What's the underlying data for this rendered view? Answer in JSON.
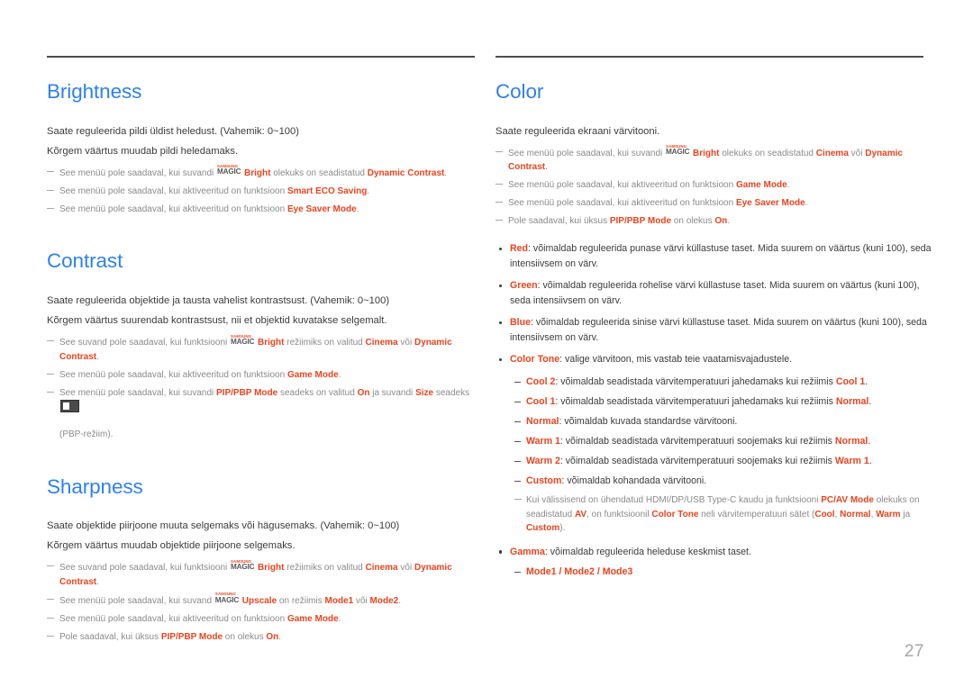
{
  "page": {
    "number": "27",
    "accent_heading_color": "#2f80ed",
    "highlight_color": "#e8441f",
    "body_color": "#3b3b3b",
    "note_color": "#8a8a8a"
  },
  "left_column": {
    "sections": [
      {
        "title": "Brightness",
        "body": [
          "Saate reguleerida pildi üldist heledust. (Vahemik: 0~100)",
          "Kõrgem väärtus muudab pildi heledamaks."
        ],
        "notes": {
          "n1_a": "See menüü pole saadaval, kui suvandi ",
          "n1_logo_top": "SAMSUNG",
          "n1_logo_bottom": "MAGIC",
          "n1_b": "Bright",
          "n1_c": " olekuks on seadistatud ",
          "n1_d": "Dynamic Contrast",
          "n1_e": ".",
          "n2_a": "See menüü pole saadaval, kui aktiveeritud on funktsioon ",
          "n2_b": "Smart ECO Saving",
          "n2_c": ".",
          "n3_a": "See menüü pole saadaval, kui aktiveeritud on funktsioon ",
          "n3_b": "Eye Saver Mode",
          "n3_c": "."
        }
      },
      {
        "title": "Contrast",
        "body": [
          "Saate reguleerida objektide ja tausta vahelist kontrastsust. (Vahemik: 0~100)",
          "Kõrgem väärtus suurendab kontrastsust, nii et objektid kuvatakse selgemalt."
        ],
        "notes": {
          "n1_a": "See suvand pole saadaval, kui funktsiooni ",
          "n1_logo_top": "SAMSUNG",
          "n1_logo_bottom": "MAGIC",
          "n1_b": "Bright",
          "n1_c": " režiimiks on valitud ",
          "n1_d": "Cinema",
          "n1_e": " või ",
          "n1_f": "Dynamic Contrast",
          "n1_g": ".",
          "n2_a": "See menüü pole saadaval, kui aktiveeritud on funktsioon ",
          "n2_b": "Game Mode",
          "n2_c": ".",
          "n3_a": "See menüü pole saadaval, kui suvandi ",
          "n3_b": "PIP/PBP Mode",
          "n3_c": " seadeks on valitud ",
          "n3_d": "On",
          "n3_e": " ja suvandi ",
          "n3_f": "Size",
          "n3_g": " seadeks ",
          "n3_h": "(PBP-režiim)."
        }
      },
      {
        "title": "Sharpness",
        "body": [
          "Saate objektide piirjoone muuta selgemaks või hägusemaks. (Vahemik: 0~100)",
          "Kõrgem väärtus muudab objektide piirjoone selgemaks."
        ],
        "notes": {
          "n1_a": "See suvand pole saadaval, kui funktsiooni ",
          "n1_logo_top": "SAMSUNG",
          "n1_logo_bottom": "MAGIC",
          "n1_b": "Bright",
          "n1_c": " režiimiks on valitud ",
          "n1_d": "Cinema",
          "n1_e": " või ",
          "n1_f": "Dynamic Contrast",
          "n1_g": ".",
          "n2_a": "See menüü pole saadaval, kui suvand ",
          "n2_logo_top": "SAMSUNG",
          "n2_logo_bottom": "MAGIC",
          "n2_b": "Upscale",
          "n2_c": " on režiimis ",
          "n2_d": "Mode1",
          "n2_e": " või ",
          "n2_f": "Mode2",
          "n2_g": ".",
          "n3_a": "See menüü pole saadaval, kui aktiveeritud on funktsioon ",
          "n3_b": "Game Mode",
          "n3_c": ".",
          "n4_a": "Pole saadaval, kui üksus ",
          "n4_b": "PIP/PBP Mode",
          "n4_c": " on olekus ",
          "n4_d": "On",
          "n4_e": "."
        }
      }
    ]
  },
  "right_column": {
    "section": {
      "title": "Color",
      "body": [
        "Saate reguleerida ekraani värvitooni."
      ],
      "notes": {
        "n1_a": "See menüü pole saadaval, kui suvandi ",
        "n1_logo_top": "SAMSUNG",
        "n1_logo_bottom": "MAGIC",
        "n1_b": "Bright",
        "n1_c": " olekuks on seadistatud ",
        "n1_d": "Cinema",
        "n1_e": " või ",
        "n1_f": "Dynamic Contrast",
        "n1_g": ".",
        "n2_a": "See menüü pole saadaval, kui aktiveeritud on funktsioon ",
        "n2_b": "Game Mode",
        "n2_c": ".",
        "n3_a": "See menüü pole saadaval, kui aktiveeritud on funktsioon ",
        "n3_b": "Eye Saver Mode",
        "n3_c": ".",
        "n4_a": "Pole saadaval, kui üksus ",
        "n4_b": "PIP/PBP Mode",
        "n4_c": " on olekus ",
        "n4_d": "On",
        "n4_e": "."
      },
      "bullets": {
        "b1_label": "Red",
        "b1_text": ": võimaldab reguleerida punase värvi küllastuse taset. Mida suurem on väärtus (kuni 100), seda intensiivsem on värv.",
        "b2_label": "Green",
        "b2_text": ": võimaldab reguleerida rohelise värvi küllastuse taset. Mida suurem on väärtus (kuni 100), seda intensiivsem on värv.",
        "b3_label": "Blue",
        "b3_text": ": võimaldab reguleerida sinise värvi küllastuse taset. Mida suurem on väärtus (kuni 100), seda intensiivsem on värv.",
        "b4_label": "Color Tone",
        "b4_text": ": valige värvitoon, mis vastab teie vaatamisvajadustele.",
        "b5_label": "Gamma",
        "b5_text": ": võimaldab reguleerida heleduse keskmist taset."
      },
      "color_tone_items": {
        "i1_label": "Cool 2",
        "i1_a": ": võimaldab seadistada värvitemperatuuri jahedamaks kui režiimis ",
        "i1_ref": "Cool 1",
        "i1_b": ".",
        "i2_label": "Cool 1",
        "i2_a": ": võimaldab seadistada värvitemperatuuri jahedamaks kui režiimis ",
        "i2_ref": "Normal",
        "i2_b": ".",
        "i3_label": "Normal",
        "i3_a": ": võimaldab kuvada standardse värvitooni.",
        "i4_label": "Warm 1",
        "i4_a": ": võimaldab seadistada värvitemperatuuri soojemaks kui režiimis ",
        "i4_ref": "Normal",
        "i4_b": ".",
        "i5_label": "Warm 2",
        "i5_a": ": võimaldab seadistada värvitemperatuuri soojemaks kui režiimis ",
        "i5_ref": "Warm 1",
        "i5_b": ".",
        "i6_label": "Custom",
        "i6_a": ": võimaldab kohandada värvitooni."
      },
      "color_tone_note": {
        "a": "Kui välissisend on ühendatud HDMI/DP/USB Type-C kaudu ja funktsiooni ",
        "b": "PC/AV Mode",
        "c": " olekuks on seadistatud ",
        "d": "AV",
        "e": ", on funktsioonil ",
        "f": "Color Tone",
        "g": " neli värvitemperatuuri sätet (",
        "h": "Cool",
        "i": ", ",
        "j": "Normal",
        "k": ", ",
        "l": "Warm",
        "m": " ja ",
        "n": "Custom",
        "o": ")."
      },
      "gamma_modes": "Mode1 / Mode2 / Mode3"
    }
  }
}
